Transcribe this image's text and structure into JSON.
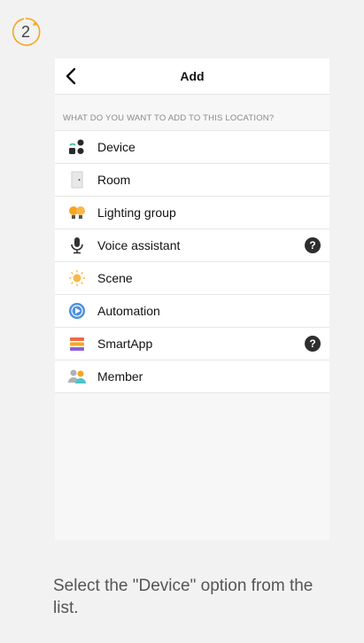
{
  "step": {
    "number": "2"
  },
  "nav": {
    "title": "Add"
  },
  "section_header": "WHAT DO YOU WANT TO ADD TO THIS LOCATION?",
  "items": [
    {
      "label": "Device",
      "icon": "device-icon",
      "help": ""
    },
    {
      "label": "Room",
      "icon": "room-icon",
      "help": ""
    },
    {
      "label": "Lighting group",
      "icon": "lighting-group-icon",
      "help": ""
    },
    {
      "label": "Voice assistant",
      "icon": "microphone-icon",
      "help": "?"
    },
    {
      "label": "Scene",
      "icon": "scene-icon",
      "help": ""
    },
    {
      "label": "Automation",
      "icon": "automation-icon",
      "help": ""
    },
    {
      "label": "SmartApp",
      "icon": "smartapp-icon",
      "help": "?"
    },
    {
      "label": "Member",
      "icon": "member-icon",
      "help": ""
    }
  ],
  "caption": "Select the \"Device\" option from the list.",
  "colors": {
    "accent": "#f5a623",
    "background": "#f2f2f2",
    "list_bg": "#ffffff"
  }
}
